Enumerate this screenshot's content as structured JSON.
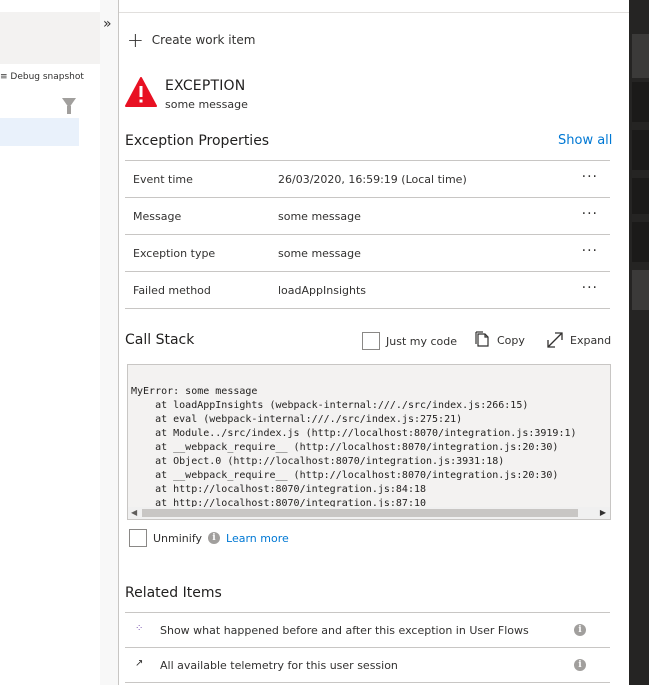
{
  "left_panel": {
    "debug_snapshot_label": "≡ Debug snapshot"
  },
  "collapse_glyph": "»",
  "create_work_item": "Create work item",
  "exception": {
    "title": "EXCEPTION",
    "message": "some message"
  },
  "properties": {
    "title": "Exception Properties",
    "show_all": "Show all",
    "rows": [
      {
        "key": "Event time",
        "value": "26/03/2020, 16:59:19 (Local time)"
      },
      {
        "key": "Message",
        "value": "some message"
      },
      {
        "key": "Exception type",
        "value": "some message"
      },
      {
        "key": "Failed method",
        "value": "loadAppInsights"
      }
    ],
    "more_glyph": "···"
  },
  "call_stack": {
    "title": "Call Stack",
    "just_my_code": "Just my code",
    "copy": "Copy",
    "expand": "Expand",
    "lines": [
      "MyError: some message",
      "    at loadAppInsights (webpack-internal:///./src/index.js:266:15)",
      "    at eval (webpack-internal:///./src/index.js:275:21)",
      "    at Module../src/index.js (http://localhost:8070/integration.js:3919:1)",
      "    at __webpack_require__ (http://localhost:8070/integration.js:20:30)",
      "    at Object.0 (http://localhost:8070/integration.js:3931:18)",
      "    at __webpack_require__ (http://localhost:8070/integration.js:20:30)",
      "    at http://localhost:8070/integration.js:84:18",
      "    at http://localhost:8070/integration.js:87:10"
    ],
    "unminify": "Unminify",
    "learn_more": "Learn more"
  },
  "related": {
    "title": "Related Items",
    "items": [
      {
        "icon": "user-flows-icon",
        "label": "Show what happened before and after this exception in User Flows"
      },
      {
        "icon": "arrow-out-icon",
        "label": "All available telemetry for this user session"
      }
    ]
  },
  "colors": {
    "accent": "#0078d4",
    "error": "#e81123",
    "selection": "#e9f1fb"
  }
}
